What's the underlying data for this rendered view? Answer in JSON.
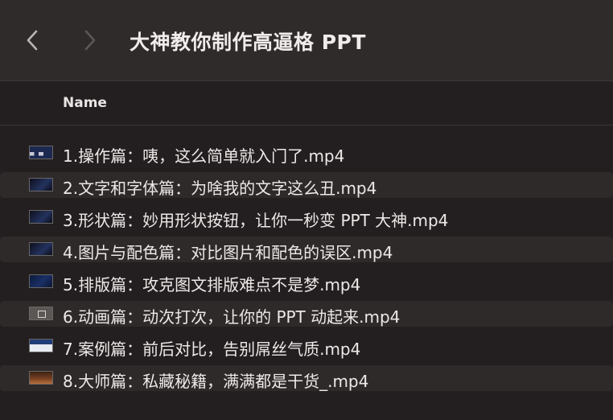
{
  "window": {
    "title": "大神教你制作高逼格 PPT"
  },
  "toolbar": {
    "back_icon": "chevron-left-icon",
    "forward_icon": "chevron-right-icon"
  },
  "columns": {
    "name": "Name"
  },
  "files": [
    {
      "name": "1.操作篇：咦，这么简单就入门了.mp4",
      "thumb": "video-thumbnail-icon"
    },
    {
      "name": "2.文字和字体篇：为啥我的文字这么丑.mp4",
      "thumb": "video-thumbnail-icon"
    },
    {
      "name": "3.形状篇：妙用形状按钮，让你一秒变 PPT 大神.mp4",
      "thumb": "video-thumbnail-icon"
    },
    {
      "name": "4.图片与配色篇：对比图片和配色的误区.mp4",
      "thumb": "video-thumbnail-icon"
    },
    {
      "name": "5.排版篇：攻克图文排版难点不是梦.mp4",
      "thumb": "video-thumbnail-icon"
    },
    {
      "name": "6.动画篇：动次打次，让你的 PPT 动起来.mp4",
      "thumb": "video-thumbnail-icon"
    },
    {
      "name": "7.案例篇：前后对比，告别屌丝气质.mp4",
      "thumb": "video-thumbnail-icon"
    },
    {
      "name": "8.大师篇：私藏秘籍，满满都是干货_.mp4",
      "thumb": "video-thumbnail-icon"
    }
  ],
  "colors": {
    "background": "#231f20",
    "toolbar": "#2f2b2b",
    "stripe": "#2e2a2a",
    "text": "#ece9e8"
  }
}
